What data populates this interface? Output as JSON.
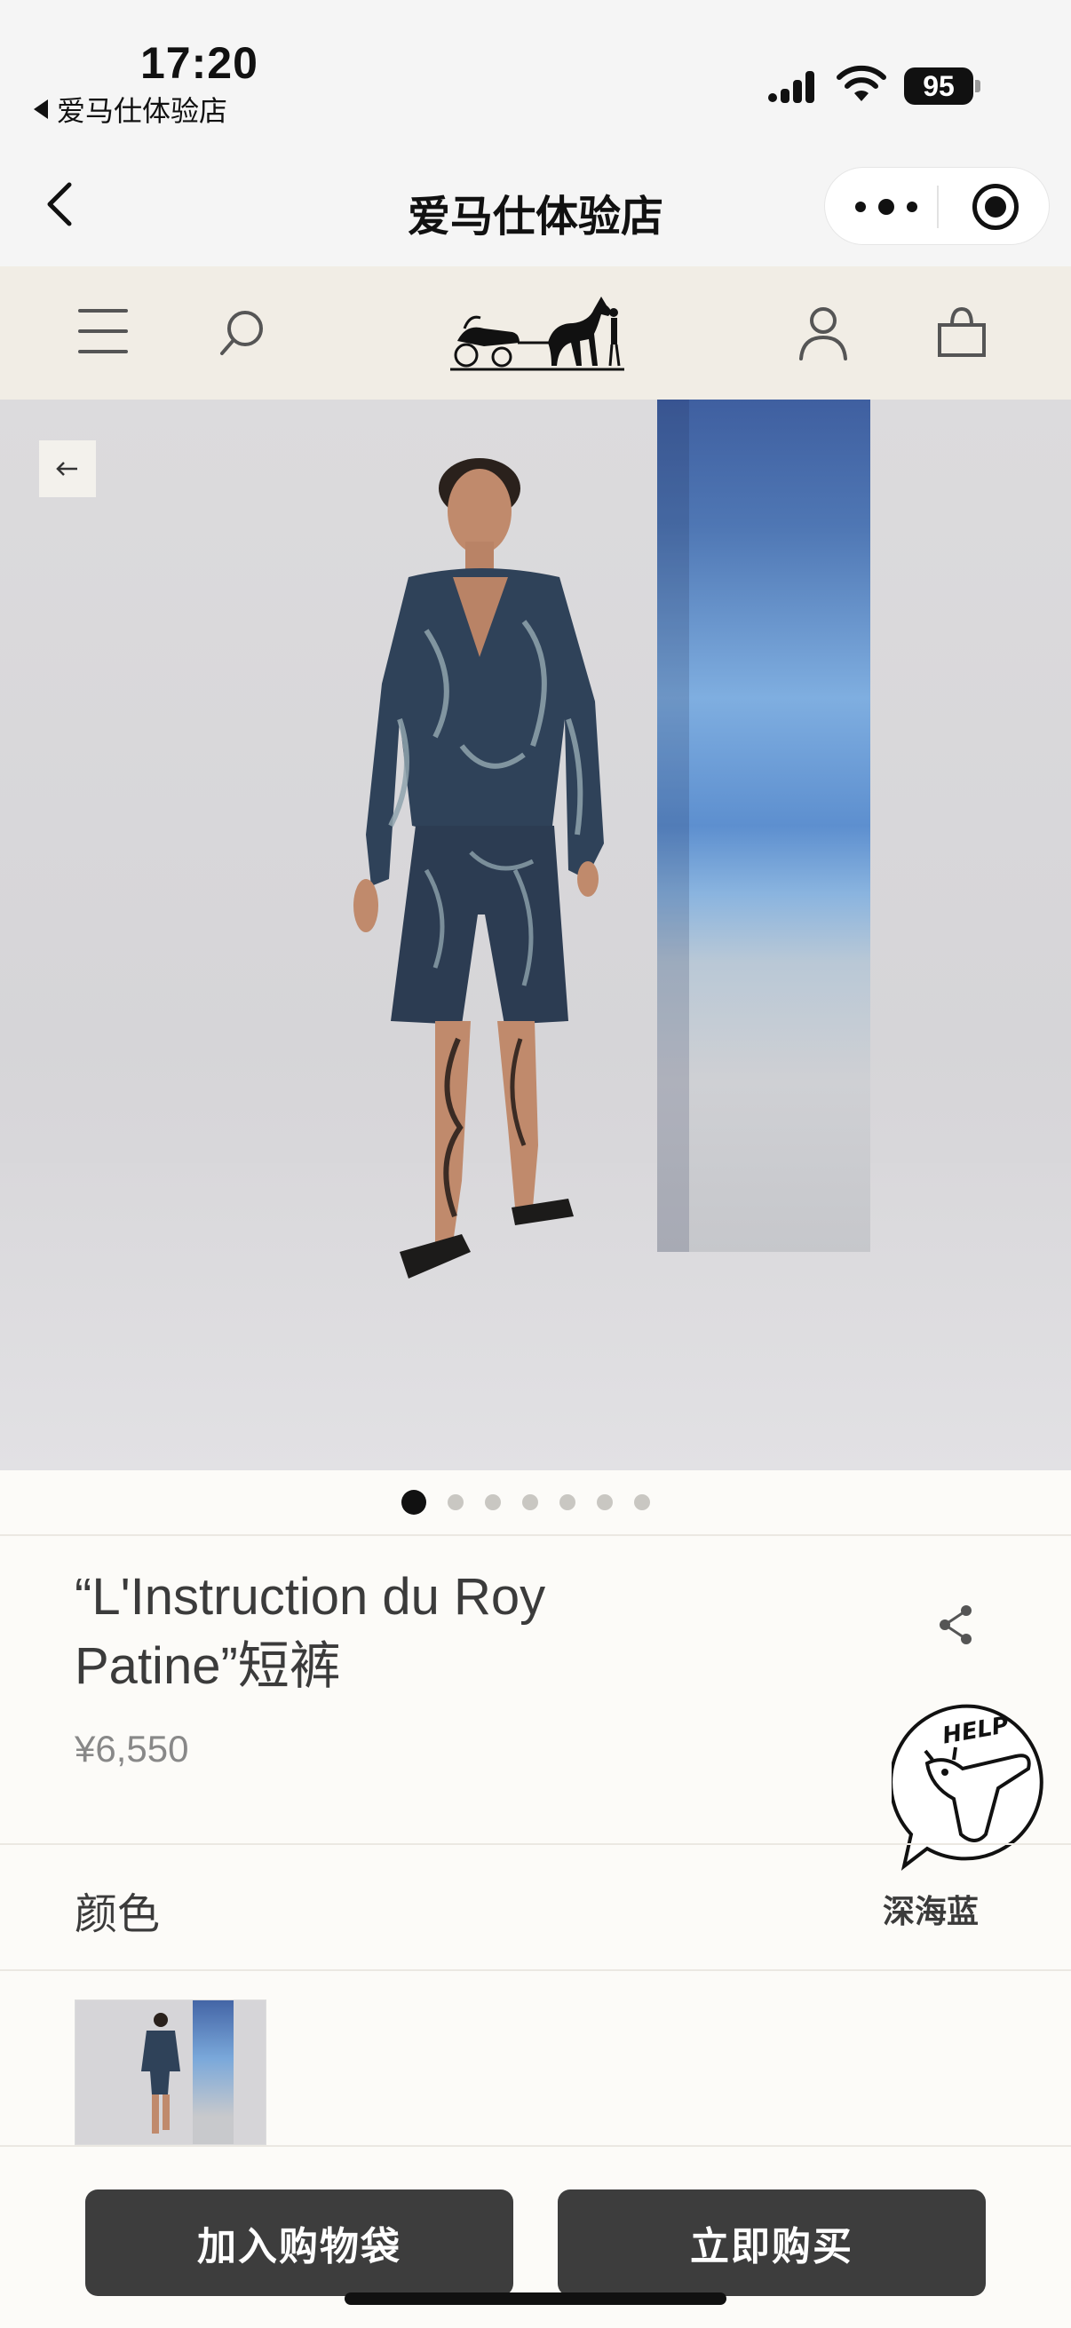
{
  "status_bar": {
    "time": "17:20",
    "back_app_label": "爱马仕体验店",
    "battery": "95"
  },
  "mini_program": {
    "title": "爱马仕体验店"
  },
  "product": {
    "title_line1": "“L'Instruction du Roy",
    "title_line2": "Patine”短裤",
    "price": "¥6,550",
    "color_label": "颜色",
    "color_value": "深海蓝",
    "image_count": 7,
    "active_image": 1
  },
  "help_badge": {
    "text": "HELP"
  },
  "actions": {
    "add_to_bag": "加入购物袋",
    "buy_now": "立即购买"
  },
  "icons": {
    "nav": [
      "menu-icon",
      "search-icon",
      "hermes-logo",
      "user-icon",
      "bag-icon"
    ]
  }
}
